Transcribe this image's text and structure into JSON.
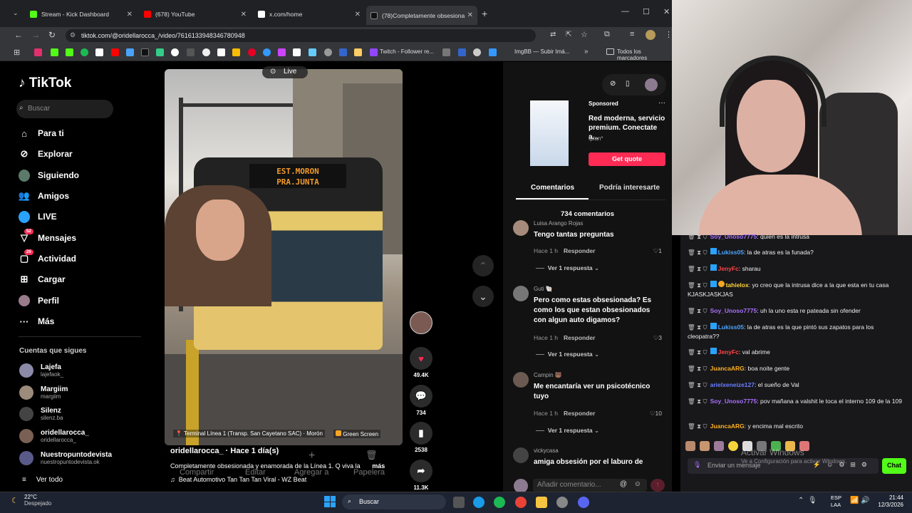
{
  "browser": {
    "tabs": [
      {
        "title": "Stream - Kick Dashboard",
        "color": "#53fc18"
      },
      {
        "title": "(678) YouTube",
        "color": "#ff0000"
      },
      {
        "title": "x.com/home",
        "color": "#ffffff"
      },
      {
        "title": "(78)Completamente obsesiona",
        "color": "#000000",
        "active": true
      }
    ],
    "url": "tiktok.com/@oridellarocca_/video/7616133948346780948",
    "bookmarks": [
      "Twitch - Follower re...",
      "ImgBB — Subir Imá...",
      "Todos los marcadores"
    ]
  },
  "tiktok": {
    "logo": "TikTok",
    "search_placeholder": "Buscar",
    "nav": [
      {
        "label": "Para ti",
        "icon": "home-icon"
      },
      {
        "label": "Explorar",
        "icon": "compass-icon"
      },
      {
        "label": "Siguiendo",
        "icon": "following-avatar-icon"
      },
      {
        "label": "Amigos",
        "icon": "friends-icon"
      },
      {
        "label": "LIVE",
        "icon": "live-icon"
      },
      {
        "label": "Mensajes",
        "icon": "messages-icon",
        "badge": "52"
      },
      {
        "label": "Actividad",
        "icon": "activity-icon",
        "badge": "26"
      },
      {
        "label": "Cargar",
        "icon": "upload-icon"
      },
      {
        "label": "Perfil",
        "icon": "profile-avatar-icon"
      },
      {
        "label": "Más",
        "icon": "more-icon"
      }
    ],
    "following_header": "Cuentas que sigues",
    "following": [
      {
        "name": "Lajefa",
        "handle": "lajefaok_"
      },
      {
        "name": "Margiim",
        "handle": "margiim"
      },
      {
        "name": "Silenz",
        "handle": "silenz.ba"
      },
      {
        "name": "oridellarocca_",
        "handle": "oridellarocca_"
      },
      {
        "name": "Nuestropuntodevista",
        "handle": "nuestropuntodevista.ok"
      }
    ],
    "see_all": "Ver todo",
    "video": {
      "live_label": "Live",
      "bus_sign_1": "EST.MORON",
      "bus_sign_2": "PRA.JUNTA",
      "location": "Terminal Línea 1 (Transp. San Cayetano SAC) · Morón",
      "effect": "Green Screen",
      "author": "oridellarocca_ · Hace 1 día(s)",
      "caption": "Completamente obsesionada y enamorada de la Línea 1. Q viva la",
      "more": "más",
      "music": "Beat Automotivo Tan Tan Tan Viral - WZ Beat",
      "overlay_actions": [
        "Compartir",
        "Editar",
        "Agregar a",
        "Papelera"
      ]
    },
    "actions": {
      "likes": "49.4K",
      "comments": "734",
      "saves": "2538",
      "shares": "11.3K"
    },
    "sponsored": {
      "label": "Sponsored",
      "title": "Red moderna, servicio premium. Conectate a...",
      "advertiser": "Iplan*",
      "cta": "Get quote"
    },
    "comment_tabs": [
      "Comentarios",
      "Podría interesarte"
    ],
    "comment_count": "734 comentarios",
    "comments": [
      {
        "user": "Luisa Arango Rojas",
        "text": "Tengo tantas preguntas",
        "time": "Hace 1 h",
        "likes": "1",
        "replies": "Ver 1 respuesta"
      },
      {
        "user": "Guti 🐚",
        "text": "Pero como estas obsesionada? Es como los que estan obsesionados con algun auto digamos?",
        "time": "Hace 1 h",
        "likes": "3",
        "replies": "Ver 1 respuesta"
      },
      {
        "user": "Campin 🐻",
        "text": "Me encantaría ver un psicotécnico tuyo",
        "time": "Hace 1 h",
        "likes": "10",
        "replies": "Ver 1 respuesta"
      },
      {
        "user": "vickycasa",
        "text": "amiga obsesión por el laburo de",
        "time": "",
        "likes": "",
        "replies": ""
      }
    ],
    "reply_label": "Responder",
    "add_comment_placeholder": "Añadir comentario..."
  },
  "chat": {
    "messages": [
      {
        "user": "Soy_Unoso7775",
        "text": "quien es la intrusa",
        "color": "#a970ff"
      },
      {
        "user": "Lukiss05",
        "text": "la de atras es la funada?",
        "color": "#4aa3ff"
      },
      {
        "user": "JenyFc",
        "text": "sharau",
        "color": "#ff4545"
      },
      {
        "user": "tahielox",
        "text": "yo creo que la intrusa dice a la que esta en tu casa KJASKJASKJAS",
        "color": "#ffd43b"
      },
      {
        "user": "Soy_Unoso7775",
        "text": "uh la uno esta re pateada sin ofender",
        "color": "#a970ff"
      },
      {
        "user": "Lukiss05",
        "text": "la de atras es la que pintó sus zapatos para los cleopatra??",
        "color": "#4aa3ff"
      },
      {
        "user": "JenyFc",
        "text": "val abrime",
        "color": "#ff4545"
      },
      {
        "user": "JuancaARG",
        "text": "boa noite gente",
        "color": "#ffb020"
      },
      {
        "user": "arielxeneize127",
        "text": "el sueño de Val",
        "color": "#6a7dff"
      },
      {
        "user": "Soy_Unoso7775",
        "text": "pov mañana a valshit le toca el interno 109 de la 109",
        "color": "#a970ff"
      },
      {
        "user": "JuancaARG",
        "text": "y encima mal escrito",
        "color": "#ffb020"
      }
    ],
    "input_placeholder": "Enviar un mensaje",
    "send_label": "Chat",
    "watermark": "Activar Windows",
    "watermark_sub": "Ve a Configuración para activar Windows."
  },
  "taskbar": {
    "weather_temp": "22°C",
    "weather_desc": "Despejado",
    "search": "Buscar",
    "lang_1": "ESP",
    "lang_2": "LAA",
    "time": "21:44",
    "date": "12/3/2026"
  }
}
